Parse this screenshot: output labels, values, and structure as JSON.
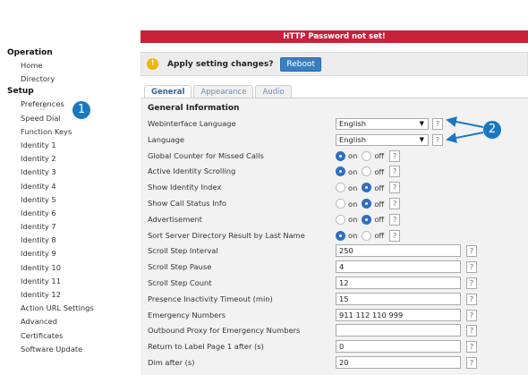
{
  "banner": {
    "text": "HTTP Password not set!"
  },
  "apply": {
    "icon": "!",
    "text": "Apply setting changes?",
    "reboot_label": "Reboot"
  },
  "tabs": [
    {
      "label": "General",
      "active": true
    },
    {
      "label": "Appearance",
      "active": false
    },
    {
      "label": "Audio",
      "active": false
    }
  ],
  "sidebar": {
    "sections": [
      {
        "title": "Operation",
        "items": [
          "Home",
          "Directory"
        ]
      },
      {
        "title": "Setup",
        "items": [
          "Preferences",
          "Speed Dial",
          "Function Keys",
          "Identity 1",
          "Identity 2",
          "Identity 3",
          "Identity 4",
          "Identity 5",
          "Identity 6",
          "Identity 7",
          "Identity 8",
          "Identity 9",
          "Identity 10",
          "Identity 11",
          "Identity 12",
          "Action URL Settings",
          "Advanced",
          "Certificates",
          "Software Update"
        ]
      }
    ]
  },
  "general": {
    "section_title": "General Information",
    "help": "?",
    "on_label": "on",
    "off_label": "off",
    "rows": [
      {
        "label": "Webinterface Language",
        "type": "select",
        "value": "English"
      },
      {
        "label": "Language",
        "type": "select",
        "value": "English"
      },
      {
        "label": "Global Counter for Missed Calls",
        "type": "radio",
        "value": "on"
      },
      {
        "label": "Active Identity Scrolling",
        "type": "radio",
        "value": "on"
      },
      {
        "label": "Show Identity Index",
        "type": "radio",
        "value": "off"
      },
      {
        "label": "Show Call Status Info",
        "type": "radio",
        "value": "off"
      },
      {
        "label": "Advertisement",
        "type": "radio",
        "value": "off"
      },
      {
        "label": "Sort Server Directory Result by Last Name",
        "type": "radio",
        "value": "on"
      },
      {
        "label": "Scroll Step Interval",
        "type": "text",
        "value": "250"
      },
      {
        "label": "Scroll Step Pause",
        "type": "text",
        "value": "4"
      },
      {
        "label": "Scroll Step Count",
        "type": "text",
        "value": "12"
      },
      {
        "label": "Presence Inactivity Timeout (min)",
        "type": "text",
        "value": "15"
      },
      {
        "label": "Emergency Numbers",
        "type": "text",
        "value": "911 112 110 999"
      },
      {
        "label": "Outbound Proxy for Emergency Numbers",
        "type": "text",
        "value": ""
      },
      {
        "label": "Return to Label Page 1 after (s)",
        "type": "text",
        "value": "0"
      },
      {
        "label": "Dim after (s)",
        "type": "text",
        "value": "20"
      }
    ]
  },
  "callouts": [
    "1",
    "2"
  ],
  "colors": {
    "banner": "#c8213a",
    "accent": "#3a7fc1",
    "callout": "#1a78c2",
    "warning": "#f0b400"
  }
}
